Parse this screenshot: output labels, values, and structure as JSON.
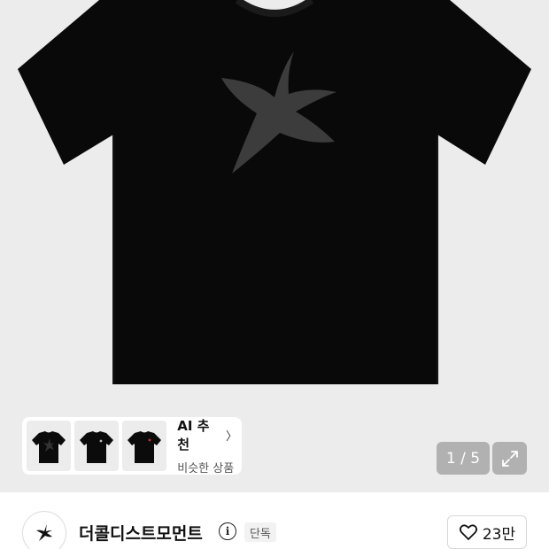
{
  "gallery": {
    "counter": "1 / 5",
    "main_image_icon": "black-tshirt-starfish-print"
  },
  "ai_recommend": {
    "title": "AI 추천",
    "subtitle": "비슷한 상품",
    "thumbnails": [
      "black-tshirt-starfish",
      "black-tshirt-logo",
      "black-tshirt-logo-2"
    ]
  },
  "brand": {
    "name": "더콜디스트모먼트",
    "badge": "단독",
    "like_count": "23만"
  },
  "icons": {
    "expand": "expand-icon",
    "info": "info-icon",
    "heart": "heart-icon",
    "chevron": "chevron-right-icon"
  }
}
